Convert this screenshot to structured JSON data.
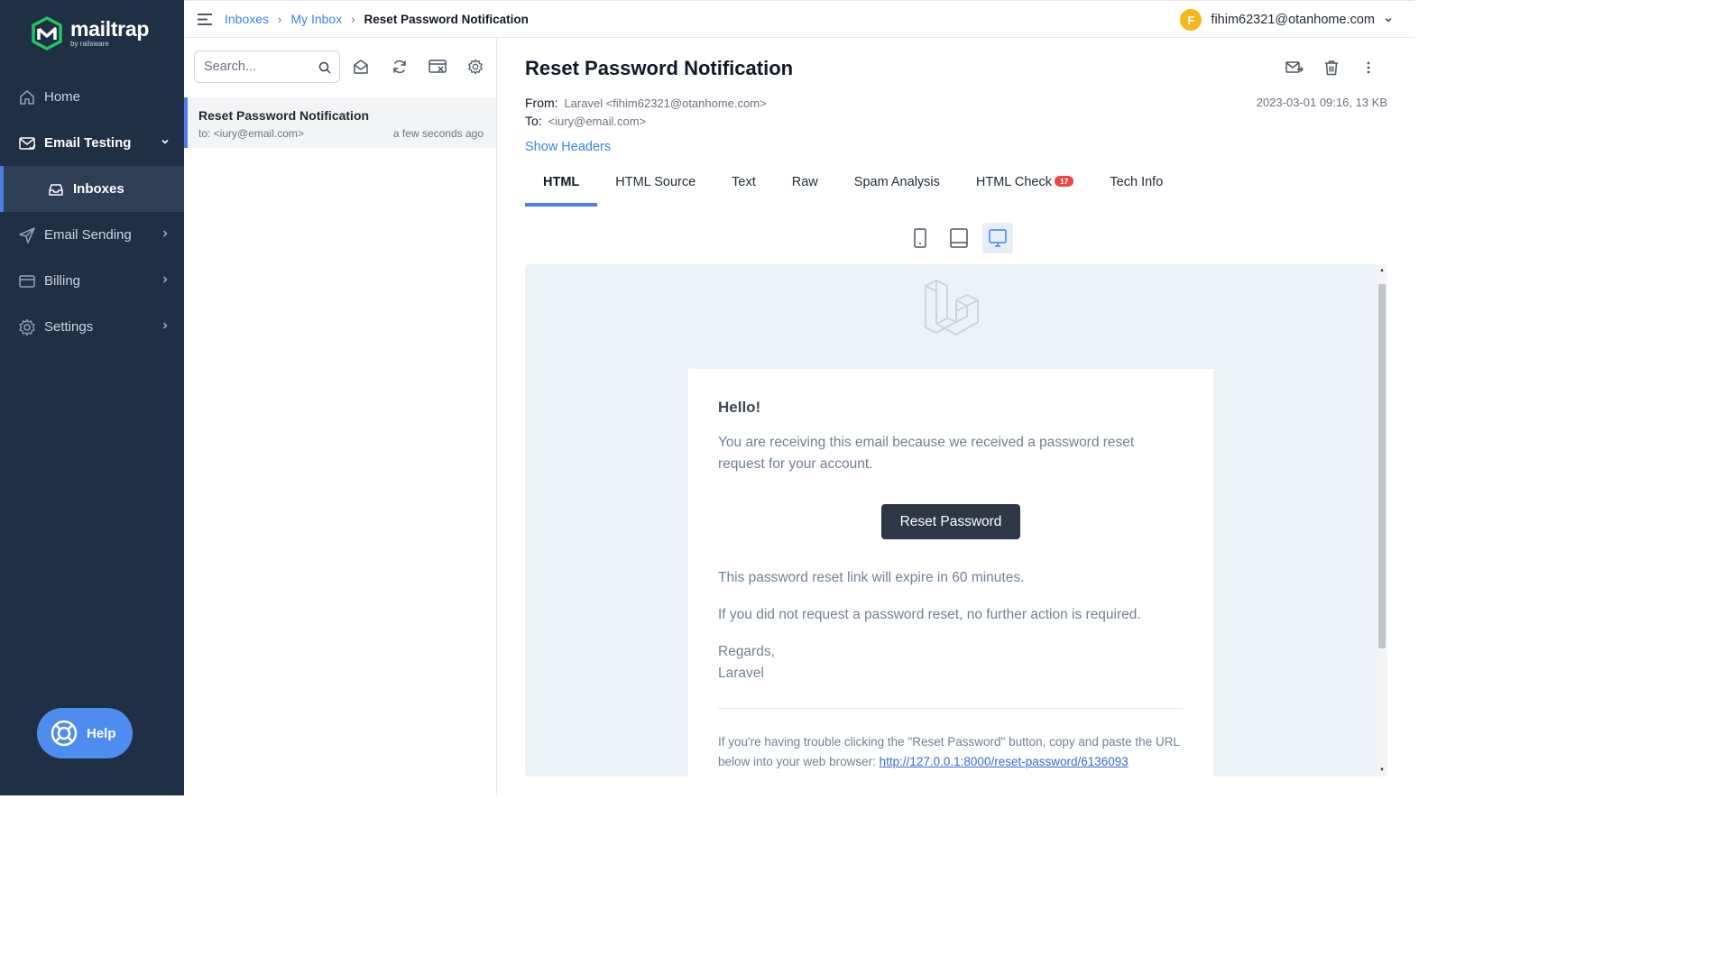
{
  "brand": {
    "name": "mailtrap",
    "sub": "by railsware"
  },
  "sidebar": {
    "items": [
      {
        "label": "Home"
      },
      {
        "label": "Email Testing"
      },
      {
        "label": "Inboxes"
      },
      {
        "label": "Email Sending"
      },
      {
        "label": "Billing"
      },
      {
        "label": "Settings"
      }
    ],
    "help_label": "Help"
  },
  "breadcrumb": {
    "items": [
      "Inboxes",
      "My Inbox",
      "Reset Password Notification"
    ]
  },
  "account": {
    "initial": "F",
    "email": "fihim62321@otanhome.com"
  },
  "search": {
    "placeholder": "Search..."
  },
  "message_list": [
    {
      "subject": "Reset Password Notification",
      "to": "to: <iury@email.com>",
      "time": "a few seconds ago"
    }
  ],
  "message": {
    "subject": "Reset Password Notification",
    "from_label": "From:",
    "from_value": "Laravel <fihim62321@otanhome.com>",
    "to_label": "To:",
    "to_value": "<iury@email.com>",
    "meta": "2023-03-01 09:16, 13 KB",
    "show_headers": "Show Headers",
    "tabs": [
      {
        "label": "HTML"
      },
      {
        "label": "HTML Source"
      },
      {
        "label": "Text"
      },
      {
        "label": "Raw"
      },
      {
        "label": "Spam Analysis"
      },
      {
        "label": "HTML Check",
        "badge": "17"
      },
      {
        "label": "Tech Info"
      }
    ]
  },
  "email": {
    "greeting": "Hello!",
    "intro": "You are receiving this email because we received a password reset request for your account.",
    "button": "Reset Password",
    "expire": "This password reset link will expire in 60 minutes.",
    "no_action": "If you did not request a password reset, no further action is required.",
    "regards": "Regards,",
    "signature": "Laravel",
    "subcopy_text": "If you're having trouble clicking the \"Reset Password\" button, copy and paste the URL below into your web browser: ",
    "subcopy_url": "http://127.0.0.1:8000/reset-password/6136093"
  },
  "colors": {
    "sidebar_bg": "#1f2f45",
    "accent": "#4f7ee6",
    "link": "#3b82f6",
    "help_bg": "#4f8cf0",
    "badge": "#ef4444",
    "avatar": "#f5b71a"
  }
}
